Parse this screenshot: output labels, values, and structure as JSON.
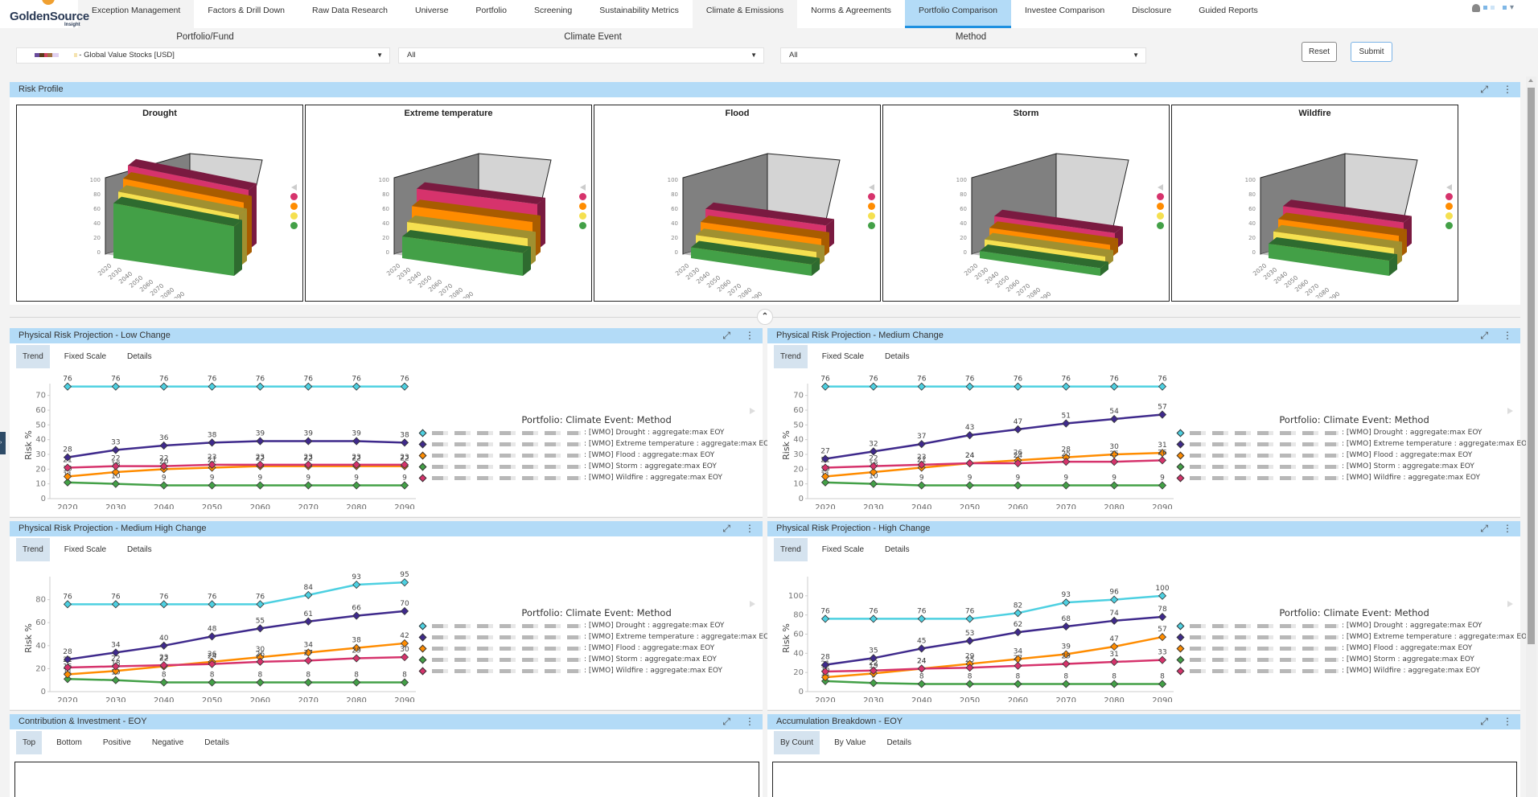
{
  "app": {
    "logo_name": "GoldenSource",
    "logo_sub": "Insight"
  },
  "nav": {
    "tabs": [
      {
        "label": "Exception Management",
        "state": "grey"
      },
      {
        "label": "Factors & Drill Down",
        "state": ""
      },
      {
        "label": "Raw Data Research",
        "state": ""
      },
      {
        "label": "Universe",
        "state": ""
      },
      {
        "label": "Portfolio",
        "state": ""
      },
      {
        "label": "Screening",
        "state": ""
      },
      {
        "label": "Sustainability Metrics",
        "state": ""
      },
      {
        "label": "Climate & Emissions",
        "state": "grey"
      },
      {
        "label": "Norms & Agreements",
        "state": ""
      },
      {
        "label": "Portfolio Comparison",
        "state": "active"
      },
      {
        "label": "Investee Comparison",
        "state": ""
      },
      {
        "label": "Disclosure",
        "state": ""
      },
      {
        "label": "Guided Reports",
        "state": ""
      }
    ]
  },
  "filters": {
    "portfolio_label": "Portfolio/Fund",
    "portfolio_value": "- Global Value Stocks [USD]",
    "climate_label": "Climate Event",
    "climate_value": "All",
    "method_label": "Method",
    "method_value": "All",
    "reset": "Reset",
    "submit": "Submit"
  },
  "risk_profile": {
    "title": "Risk Profile",
    "charts": [
      "Drought",
      "Extreme temperature",
      "Flood",
      "Storm",
      "Wildfire"
    ],
    "z_ticks": [
      "100",
      "80",
      "60",
      "40",
      "20",
      "0"
    ],
    "x_ticks": [
      "2020",
      "2030",
      "2040",
      "2050",
      "2060",
      "2070",
      "2080",
      "2090"
    ],
    "legend_colors": [
      "#d6336c",
      "#ff8c00",
      "#f5e050",
      "#43a047"
    ]
  },
  "series_meta": [
    {
      "name": "[WMO] Drought : aggregate:max EOY",
      "color": "#4dd0e1"
    },
    {
      "name": "[WMO] Extreme temperature : aggregate:max EOY",
      "color": "#3f2a8c"
    },
    {
      "name": "[WMO] Flood : aggregate:max EOY",
      "color": "#ff8c00"
    },
    {
      "name": "[WMO] Storm : aggregate:max EOY",
      "color": "#43a047"
    },
    {
      "name": "[WMO] Wildfire : aggregate:max EOY",
      "color": "#d6336c"
    }
  ],
  "subtabs": {
    "trend": "Trend",
    "fixed": "Fixed Scale",
    "details": "Details"
  },
  "legend_title": "Portfolio: Climate Event: Method",
  "ylabel": "Risk %",
  "chart_data": [
    {
      "type": "line",
      "title": "Physical Risk Projection - Low Change",
      "x": [
        "2020",
        "2030",
        "2040",
        "2050",
        "2060",
        "2070",
        "2080",
        "2090"
      ],
      "ylabel": "Risk %",
      "ylim": [
        0,
        78
      ],
      "yticks": [
        0,
        10,
        20,
        30,
        40,
        50,
        60,
        70
      ],
      "series": [
        {
          "name": "[WMO] Drought : aggregate:max EOY",
          "values": [
            76,
            76,
            76,
            76,
            76,
            76,
            76,
            76
          ]
        },
        {
          "name": "[WMO] Extreme temperature : aggregate:max EOY",
          "values": [
            28,
            33,
            36,
            38,
            39,
            39,
            39,
            38
          ]
        },
        {
          "name": "[WMO] Flood : aggregate:max EOY",
          "values": [
            15,
            18,
            20,
            21,
            22,
            22,
            22,
            22
          ]
        },
        {
          "name": "[WMO] Storm : aggregate:max EOY",
          "values": [
            11,
            10,
            9,
            9,
            9,
            9,
            9,
            9
          ]
        },
        {
          "name": "[WMO] Wildfire : aggregate:max EOY",
          "values": [
            21,
            22,
            22,
            23,
            23,
            23,
            23,
            23
          ]
        }
      ]
    },
    {
      "type": "line",
      "title": "Physical Risk Projection - Medium Change",
      "x": [
        "2020",
        "2030",
        "2040",
        "2050",
        "2060",
        "2070",
        "2080",
        "2090"
      ],
      "ylabel": "Risk %",
      "ylim": [
        0,
        78
      ],
      "yticks": [
        0,
        10,
        20,
        30,
        40,
        50,
        60,
        70
      ],
      "series": [
        {
          "name": "[WMO] Drought : aggregate:max EOY",
          "values": [
            76,
            76,
            76,
            76,
            76,
            76,
            76,
            76
          ]
        },
        {
          "name": "[WMO] Extreme temperature : aggregate:max EOY",
          "values": [
            27,
            32,
            37,
            43,
            47,
            51,
            54,
            57
          ]
        },
        {
          "name": "[WMO] Flood : aggregate:max EOY",
          "values": [
            15,
            18,
            21,
            24,
            26,
            28,
            30,
            31
          ]
        },
        {
          "name": "[WMO] Storm : aggregate:max EOY",
          "values": [
            11,
            10,
            9,
            9,
            9,
            9,
            9,
            9
          ]
        },
        {
          "name": "[WMO] Wildfire : aggregate:max EOY",
          "values": [
            21,
            22,
            23,
            24,
            24,
            25,
            25,
            26
          ]
        }
      ]
    },
    {
      "type": "line",
      "title": "Physical Risk Projection - Medium High Change",
      "x": [
        "2020",
        "2030",
        "2040",
        "2050",
        "2060",
        "2070",
        "2080",
        "2090"
      ],
      "ylabel": "Risk %",
      "ylim": [
        0,
        100
      ],
      "yticks": [
        0,
        20,
        40,
        60,
        80
      ],
      "series": [
        {
          "name": "[WMO] Drought : aggregate:max EOY",
          "values": [
            76,
            76,
            76,
            76,
            76,
            84,
            93,
            95
          ]
        },
        {
          "name": "[WMO] Extreme temperature : aggregate:max EOY",
          "values": [
            28,
            34,
            40,
            48,
            55,
            61,
            66,
            70
          ]
        },
        {
          "name": "[WMO] Flood : aggregate:max EOY",
          "values": [
            15,
            18,
            22,
            26,
            30,
            34,
            38,
            42
          ]
        },
        {
          "name": "[WMO] Storm : aggregate:max EOY",
          "values": [
            11,
            10,
            8,
            8,
            8,
            8,
            8,
            8
          ]
        },
        {
          "name": "[WMO] Wildfire : aggregate:max EOY",
          "values": [
            21,
            22,
            23,
            24,
            26,
            27,
            29,
            30
          ]
        }
      ]
    },
    {
      "type": "line",
      "title": "Physical Risk Projection - High Change",
      "x": [
        "2020",
        "2030",
        "2040",
        "2050",
        "2060",
        "2070",
        "2080",
        "2090"
      ],
      "ylabel": "Risk %",
      "ylim": [
        0,
        120
      ],
      "yticks": [
        0,
        20,
        40,
        60,
        80,
        100
      ],
      "series": [
        {
          "name": "[WMO] Drought : aggregate:max EOY",
          "values": [
            76,
            76,
            76,
            76,
            82,
            93,
            96,
            100
          ]
        },
        {
          "name": "[WMO] Extreme temperature : aggregate:max EOY",
          "values": [
            28,
            35,
            45,
            53,
            62,
            68,
            74,
            78
          ]
        },
        {
          "name": "[WMO] Flood : aggregate:max EOY",
          "values": [
            15,
            19,
            24,
            29,
            34,
            39,
            47,
            57
          ]
        },
        {
          "name": "[WMO] Storm : aggregate:max EOY",
          "values": [
            11,
            9,
            8,
            8,
            8,
            8,
            8,
            8
          ]
        },
        {
          "name": "[WMO] Wildfire : aggregate:max EOY",
          "values": [
            21,
            22,
            24,
            25,
            27,
            29,
            31,
            33
          ]
        }
      ]
    }
  ],
  "bottom": {
    "left_title": "Contribution & Investment - EOY",
    "left_tabs": [
      "Top",
      "Bottom",
      "Positive",
      "Negative",
      "Details"
    ],
    "right_title": "Accumulation Breakdown - EOY",
    "right_tabs": [
      "By Count",
      "By Value",
      "Details"
    ]
  }
}
